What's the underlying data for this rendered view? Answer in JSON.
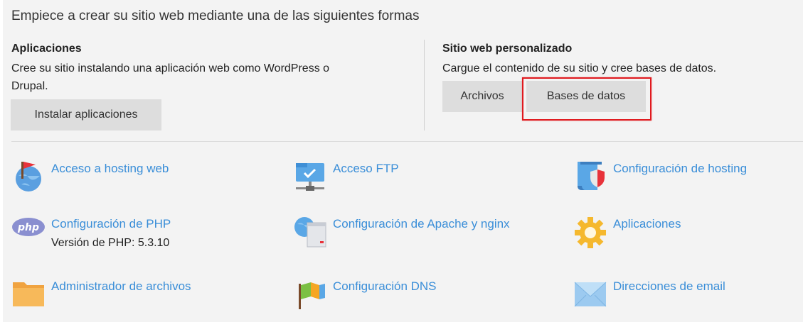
{
  "intro": "Empiece a crear su sitio web mediante una de las siguientes formas",
  "apps_section": {
    "title": "Aplicaciones",
    "desc_line1": "Cree su sitio instalando una aplicación web como WordPress o",
    "desc_line2": "Drupal.",
    "button": "Instalar aplicaciones"
  },
  "custom_section": {
    "title": "Sitio web personalizado",
    "desc": "Cargue el contenido de su sitio y cree bases de datos.",
    "files_button": "Archivos",
    "db_button": "Bases de datos",
    "highlight_color": "#e0191e"
  },
  "tools": [
    {
      "label": "Acceso a hosting web",
      "icon": "globe-flag-icon"
    },
    {
      "label": "Acceso FTP",
      "icon": "ftp-folder-icon"
    },
    {
      "label": "Configuración de hosting",
      "icon": "hosting-shield-icon"
    },
    {
      "label": "Configuración de PHP",
      "sub": "Versión de PHP: 5.3.10",
      "icon": "php-icon"
    },
    {
      "label": "Configuración de Apache y nginx",
      "icon": "server-globe-icon"
    },
    {
      "label": "Aplicaciones",
      "icon": "gear-icon"
    },
    {
      "label": "Administrador de archivos",
      "icon": "folder-icon"
    },
    {
      "label": "Configuración DNS",
      "icon": "dns-flags-icon"
    },
    {
      "label": "Direcciones de email",
      "icon": "envelope-icon"
    }
  ],
  "colors": {
    "link": "#3a8ed8",
    "button_bg": "#dddddd",
    "panel_bg": "#f3f3f3"
  }
}
